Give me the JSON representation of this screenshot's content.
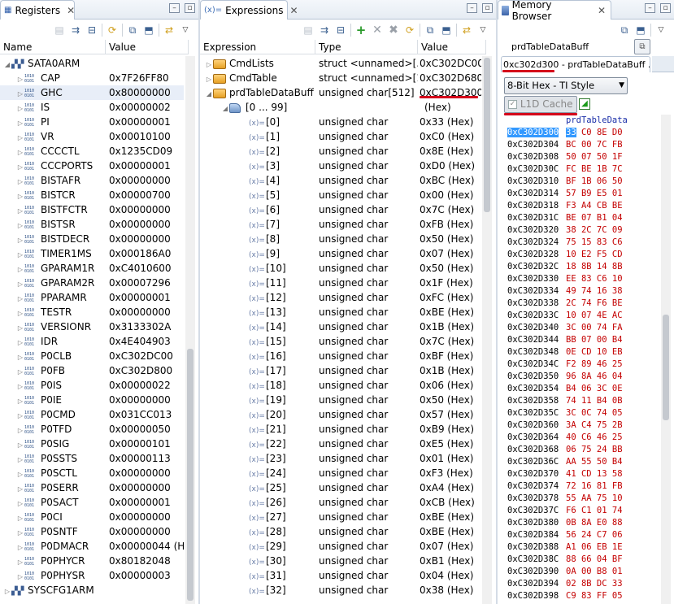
{
  "registers": {
    "tab_title": "Registers",
    "columns": [
      "Name",
      "Value"
    ],
    "group_top": "SATA0ARM",
    "rows": [
      [
        "CAP",
        "0x7F26FF80"
      ],
      [
        "GHC",
        "0x80000000"
      ],
      [
        "IS",
        "0x00000002"
      ],
      [
        "PI",
        "0x00000001"
      ],
      [
        "VR",
        "0x00010100"
      ],
      [
        "CCCCTL",
        "0x1235CD09"
      ],
      [
        "CCCPORTS",
        "0x00000001"
      ],
      [
        "BISTAFR",
        "0x00000000"
      ],
      [
        "BISTCR",
        "0x00000700"
      ],
      [
        "BISTFCTR",
        "0x00000000"
      ],
      [
        "BISTSR",
        "0x00000000"
      ],
      [
        "BISTDECR",
        "0x00000000"
      ],
      [
        "TIMER1MS",
        "0x000186A0"
      ],
      [
        "GPARAM1R",
        "0xC4010600"
      ],
      [
        "GPARAM2R",
        "0x00007296"
      ],
      [
        "PPARAMR",
        "0x00000001"
      ],
      [
        "TESTR",
        "0x00000000"
      ],
      [
        "VERSIONR",
        "0x3133302A"
      ],
      [
        "IDR",
        "0x4E404903"
      ],
      [
        "P0CLB",
        "0xC302DC00"
      ],
      [
        "P0FB",
        "0xC302D800"
      ],
      [
        "P0IS",
        "0x00000022"
      ],
      [
        "P0IE",
        "0x00000000"
      ],
      [
        "P0CMD",
        "0x031CC013"
      ],
      [
        "P0TFD",
        "0x00000050"
      ],
      [
        "P0SIG",
        "0x00000101"
      ],
      [
        "P0SSTS",
        "0x00000113"
      ],
      [
        "P0SCTL",
        "0x00000000"
      ],
      [
        "P0SERR",
        "0x00000000"
      ],
      [
        "P0SACT",
        "0x00000001"
      ],
      [
        "P0CI",
        "0x00000000"
      ],
      [
        "P0SNTF",
        "0x00000000"
      ],
      [
        "P0DMACR",
        "0x00000044 (H..."
      ],
      [
        "P0PHYCR",
        "0x80182048"
      ],
      [
        "P0PHYSR",
        "0x00000003"
      ]
    ],
    "group_bottom": "SYSCFG1ARM"
  },
  "expressions": {
    "tab_title": "Expressions",
    "columns": [
      "Expression",
      "Type",
      "Value"
    ],
    "top_rows": [
      {
        "name": "CmdLists",
        "type": "struct <unnamed>[...",
        "value": "0xC302DC00"
      },
      {
        "name": "CmdTable",
        "type": "struct <unnamed>[1]",
        "value": "0xC302D680"
      },
      {
        "name": "prdTableDataBuff",
        "type": "unsigned char[512]",
        "value": "0xC302D300 (..."
      },
      {
        "name": "[0 ... 99]",
        "type": "",
        "value": "(Hex)"
      }
    ],
    "element_type": "unsigned char",
    "elements": [
      [
        "[0]",
        "0x33 (Hex)"
      ],
      [
        "[1]",
        "0xC0 (Hex)"
      ],
      [
        "[2]",
        "0x8E (Hex)"
      ],
      [
        "[3]",
        "0xD0 (Hex)"
      ],
      [
        "[4]",
        "0xBC (Hex)"
      ],
      [
        "[5]",
        "0x00 (Hex)"
      ],
      [
        "[6]",
        "0x7C (Hex)"
      ],
      [
        "[7]",
        "0xFB (Hex)"
      ],
      [
        "[8]",
        "0x50 (Hex)"
      ],
      [
        "[9]",
        "0x07 (Hex)"
      ],
      [
        "[10]",
        "0x50 (Hex)"
      ],
      [
        "[11]",
        "0x1F (Hex)"
      ],
      [
        "[12]",
        "0xFC (Hex)"
      ],
      [
        "[13]",
        "0xBE (Hex)"
      ],
      [
        "[14]",
        "0x1B (Hex)"
      ],
      [
        "[15]",
        "0x7C (Hex)"
      ],
      [
        "[16]",
        "0xBF (Hex)"
      ],
      [
        "[17]",
        "0x1B (Hex)"
      ],
      [
        "[18]",
        "0x06 (Hex)"
      ],
      [
        "[19]",
        "0x50 (Hex)"
      ],
      [
        "[20]",
        "0x57 (Hex)"
      ],
      [
        "[21]",
        "0xB9 (Hex)"
      ],
      [
        "[22]",
        "0xE5 (Hex)"
      ],
      [
        "[23]",
        "0x01 (Hex)"
      ],
      [
        "[24]",
        "0xF3 (Hex)"
      ],
      [
        "[25]",
        "0xA4 (Hex)"
      ],
      [
        "[26]",
        "0xCB (Hex)"
      ],
      [
        "[27]",
        "0xBE (Hex)"
      ],
      [
        "[28]",
        "0xBE (Hex)"
      ],
      [
        "[29]",
        "0x07 (Hex)"
      ],
      [
        "[30]",
        "0xB1 (Hex)"
      ],
      [
        "[31]",
        "0x04 (Hex)"
      ],
      [
        "[32]",
        "0x38 (Hex)"
      ]
    ]
  },
  "memory": {
    "tab_title": "Memory Browser",
    "address_input": "prdTableDataBuff",
    "subtab_addr": "0xc302d300",
    "subtab_name": " - prdTableDataBuff ...",
    "format_select": "8-Bit Hex - TI Style",
    "cache_label": "L1D Cache",
    "symbol_label": "prdTableData",
    "first_addr": "0xC302D300",
    "first_byte": "33",
    "first_rest": " C0 8E D0",
    "rows": [
      [
        "0xC302D304",
        "BC 00 7C FB"
      ],
      [
        "0xC302D308",
        "50 07 50 1F"
      ],
      [
        "0xC302D30C",
        "FC BE 1B 7C"
      ],
      [
        "0xC302D310",
        "BF 1B 06 50"
      ],
      [
        "0xC302D314",
        "57 B9 E5 01"
      ],
      [
        "0xC302D318",
        "F3 A4 CB BE"
      ],
      [
        "0xC302D31C",
        "BE 07 B1 04"
      ],
      [
        "0xC302D320",
        "38 2C 7C 09"
      ],
      [
        "0xC302D324",
        "75 15 83 C6"
      ],
      [
        "0xC302D328",
        "10 E2 F5 CD"
      ],
      [
        "0xC302D32C",
        "18 8B 14 8B"
      ],
      [
        "0xC302D330",
        "EE 83 C6 10"
      ],
      [
        "0xC302D334",
        "49 74 16 38"
      ],
      [
        "0xC302D338",
        "2C 74 F6 BE"
      ],
      [
        "0xC302D33C",
        "10 07 4E AC"
      ],
      [
        "0xC302D340",
        "3C 00 74 FA"
      ],
      [
        "0xC302D344",
        "BB 07 00 B4"
      ],
      [
        "0xC302D348",
        "0E CD 10 EB"
      ],
      [
        "0xC302D34C",
        "F2 89 46 25"
      ],
      [
        "0xC302D350",
        "96 8A 46 04"
      ],
      [
        "0xC302D354",
        "B4 06 3C 0E"
      ],
      [
        "0xC302D358",
        "74 11 B4 0B"
      ],
      [
        "0xC302D35C",
        "3C 0C 74 05"
      ],
      [
        "0xC302D360",
        "3A C4 75 2B"
      ],
      [
        "0xC302D364",
        "40 C6 46 25"
      ],
      [
        "0xC302D368",
        "06 75 24 BB"
      ],
      [
        "0xC302D36C",
        "AA 55 50 B4"
      ],
      [
        "0xC302D370",
        "41 CD 13 58"
      ],
      [
        "0xC302D374",
        "72 16 81 FB"
      ],
      [
        "0xC302D378",
        "55 AA 75 10"
      ],
      [
        "0xC302D37C",
        "F6 C1 01 74"
      ],
      [
        "0xC302D380",
        "0B 8A E0 88"
      ],
      [
        "0xC302D384",
        "56 24 C7 06"
      ],
      [
        "0xC302D388",
        "A1 06 EB 1E"
      ],
      [
        "0xC302D38C",
        "88 66 04 BF"
      ],
      [
        "0xC302D390",
        "0A 00 B8 01"
      ],
      [
        "0xC302D394",
        "02 8B DC 33"
      ],
      [
        "0xC302D398",
        "C9 83 FF 05"
      ]
    ]
  },
  "colors": {
    "accent_red": "#d4001a",
    "selection_blue": "#3399ff",
    "byte_red": "#c40000"
  }
}
